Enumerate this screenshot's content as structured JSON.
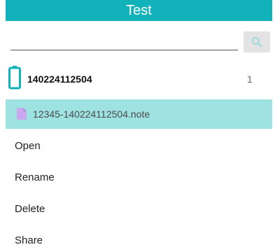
{
  "header": {
    "title": "Test"
  },
  "search": {
    "value": "",
    "placeholder": ""
  },
  "folder": {
    "name": "140224112504",
    "count": "1"
  },
  "file": {
    "name": "12345-140224112504.note"
  },
  "menu": [
    "Open",
    "Rename",
    "Delete",
    "Share"
  ],
  "colors": {
    "accent": "#12b2ba",
    "selected_row": "#9ee3e1",
    "file_icon": "#c9a8f0"
  },
  "icons": {
    "search": "search-icon",
    "folder": "phone-icon",
    "file": "file-icon"
  }
}
